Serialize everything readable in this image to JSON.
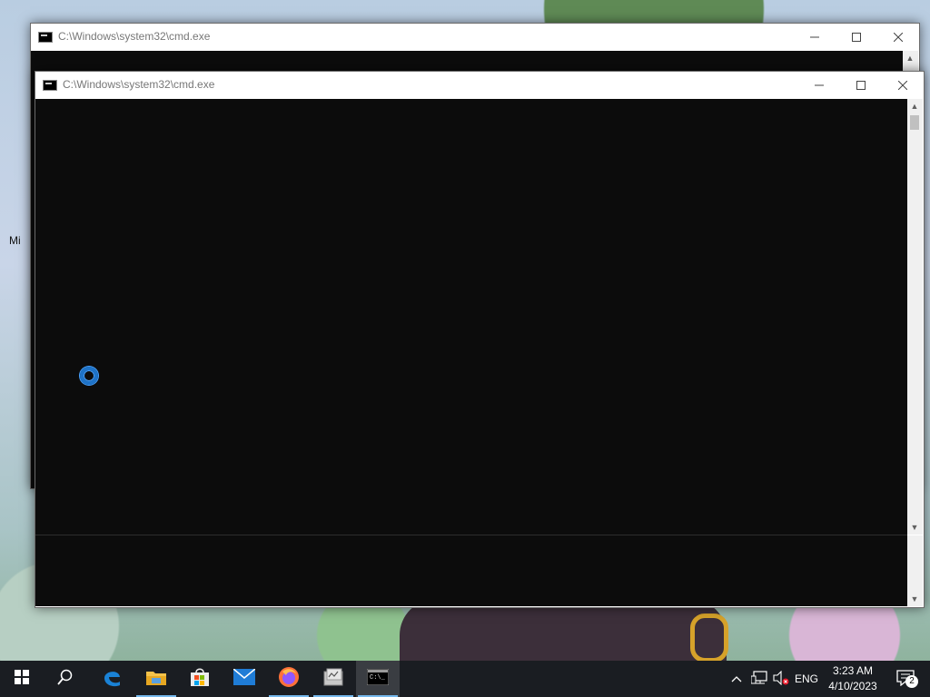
{
  "desktop": {
    "partial_label": "Mi"
  },
  "window_back": {
    "title": "C:\\Windows\\system32\\cmd.exe"
  },
  "window_front": {
    "title": "C:\\Windows\\system32\\cmd.exe"
  },
  "controls": {
    "minimize_icon": "minimize-icon",
    "maximize_icon": "maximize-icon",
    "close_icon": "close-icon"
  },
  "taskbar": {
    "buttons": [
      {
        "name": "start",
        "icon": "windows-logo-icon"
      },
      {
        "name": "search",
        "icon": "search-icon"
      },
      {
        "name": "edge",
        "icon": "edge-icon"
      },
      {
        "name": "file-explorer",
        "icon": "folder-icon"
      },
      {
        "name": "store",
        "icon": "store-bag-icon"
      },
      {
        "name": "mail",
        "icon": "mail-icon"
      },
      {
        "name": "firefox",
        "icon": "firefox-icon"
      },
      {
        "name": "app",
        "icon": "app-window-icon"
      },
      {
        "name": "cmd",
        "icon": "terminal-icon"
      }
    ],
    "tray": {
      "language": "ENG",
      "time": "3:23 AM",
      "date": "4/10/2023",
      "notifications_count": "2"
    }
  },
  "colors": {
    "console_bg": "#0c0c0c",
    "taskbar_bg": "#1a1d22",
    "accent": "#76b9ed",
    "spinner": "#1e73c8"
  }
}
